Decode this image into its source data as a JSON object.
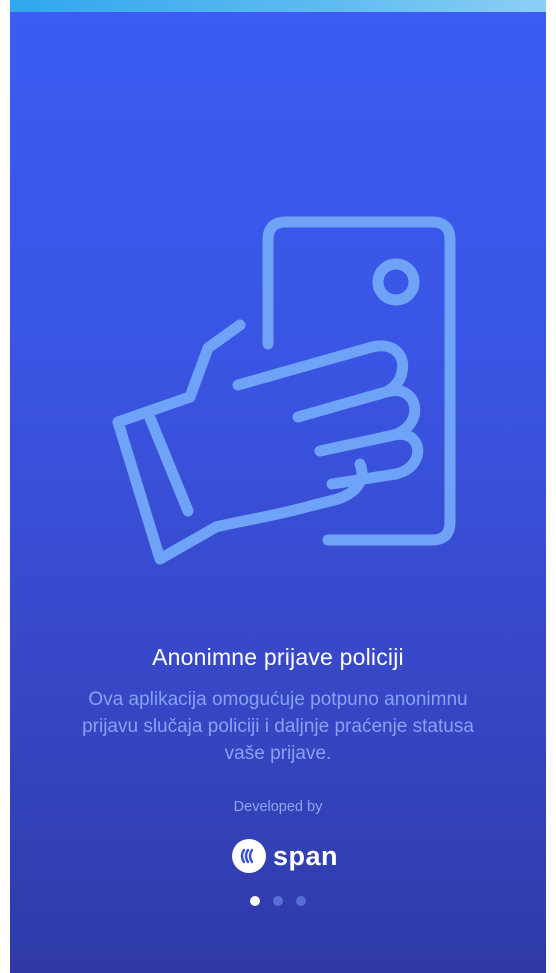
{
  "onboarding": {
    "title": "Anonimne prijave policiji",
    "description": "Ova aplikacija omogućuje potpuno anonimnu prijavu slučaja policiji i daljnje praćenje statusa vaše prijave.",
    "developed_label": "Developed by",
    "brand_name": "span",
    "illustration_icon": "hand-holding-phone-icon",
    "pager": {
      "total": 3,
      "active_index": 0
    }
  },
  "colors": {
    "gradient_top": "#3b5df3",
    "gradient_bottom": "#2f3aa7",
    "illustration": "#6fa3f7",
    "title": "#ffffff",
    "description": "#86a3f2"
  }
}
